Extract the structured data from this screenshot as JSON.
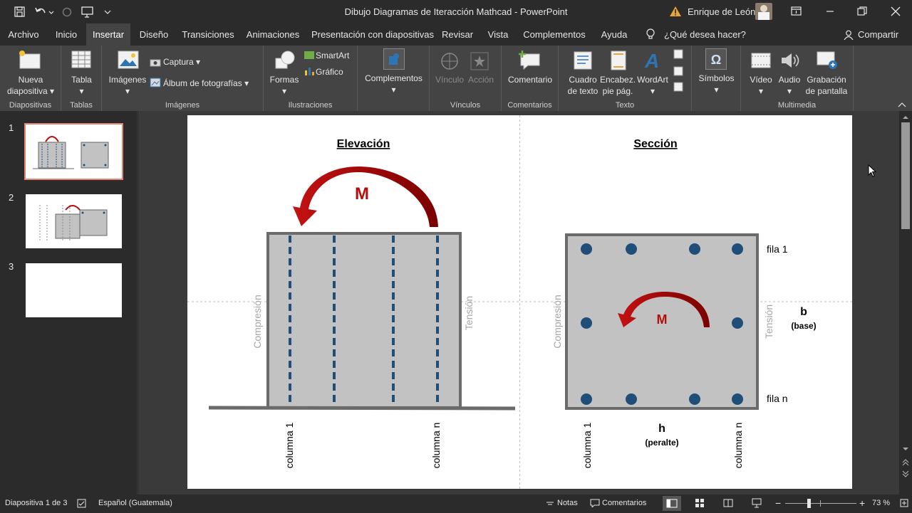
{
  "titlebar": {
    "doc_title": "Dibujo Diagramas de Iteracción Mathcad  -  PowerPoint",
    "user": "Enrique de León"
  },
  "menu": {
    "tabs": [
      "Archivo",
      "Inicio",
      "Insertar",
      "Diseño",
      "Transiciones",
      "Animaciones",
      "Presentación con diapositivas",
      "Revisar",
      "Vista",
      "Complementos",
      "Ayuda"
    ],
    "search": "¿Qué desea hacer?",
    "share": "Compartir"
  },
  "ribbon": {
    "nueva": "Nueva",
    "diapositiva": "diapositiva",
    "tabla": "Tabla",
    "imagenes": "Imágenes",
    "captura": "Captura",
    "album": "Álbum de fotografías",
    "formas": "Formas",
    "smartart": "SmartArt",
    "grafico": "Gráfico",
    "complementos": "Complementos",
    "vinculo": "Vínculo",
    "accion": "Acción",
    "comentario": "Comentario",
    "cuadro": "Cuadro",
    "detexto": "de texto",
    "encabez": "Encabez.",
    "piepag": "pie pág.",
    "wordart": "WordArt",
    "simbolos": "Símbolos",
    "video": "Vídeo",
    "audio": "Audio",
    "grabacion": "Grabación",
    "depantalla": "de pantalla",
    "groups": {
      "diapositivas": "Diapositivas",
      "tablas": "Tablas",
      "imagenes": "Imágenes",
      "ilustraciones": "Ilustraciones",
      "vinculos": "Vínculos",
      "comentarios": "Comentarios",
      "texto": "Texto",
      "multimedia": "Multimedia"
    }
  },
  "thumbnails": [
    "1",
    "2",
    "3"
  ],
  "slide": {
    "elev_title": "Elevación",
    "sec_title": "Sección",
    "moment": "M",
    "compresion": "Compresión",
    "tension": "Tensión",
    "columna1": "columna 1",
    "columnan": "columna n",
    "fila1": "fila 1",
    "filan": "fila n",
    "b": "b",
    "base": "(base)",
    "h": "h",
    "peralte": "(peralte)"
  },
  "status": {
    "slide": "Diapositiva 1 de 3",
    "lang": "Español (Guatemala)",
    "notes": "Notas",
    "comments": "Comentarios",
    "zoom": "73 %"
  },
  "colors": {
    "red": "#b50d0d",
    "blue": "#1f4e79",
    "section_fill": "#c2c2c2",
    "border": "#6b6b6b"
  }
}
